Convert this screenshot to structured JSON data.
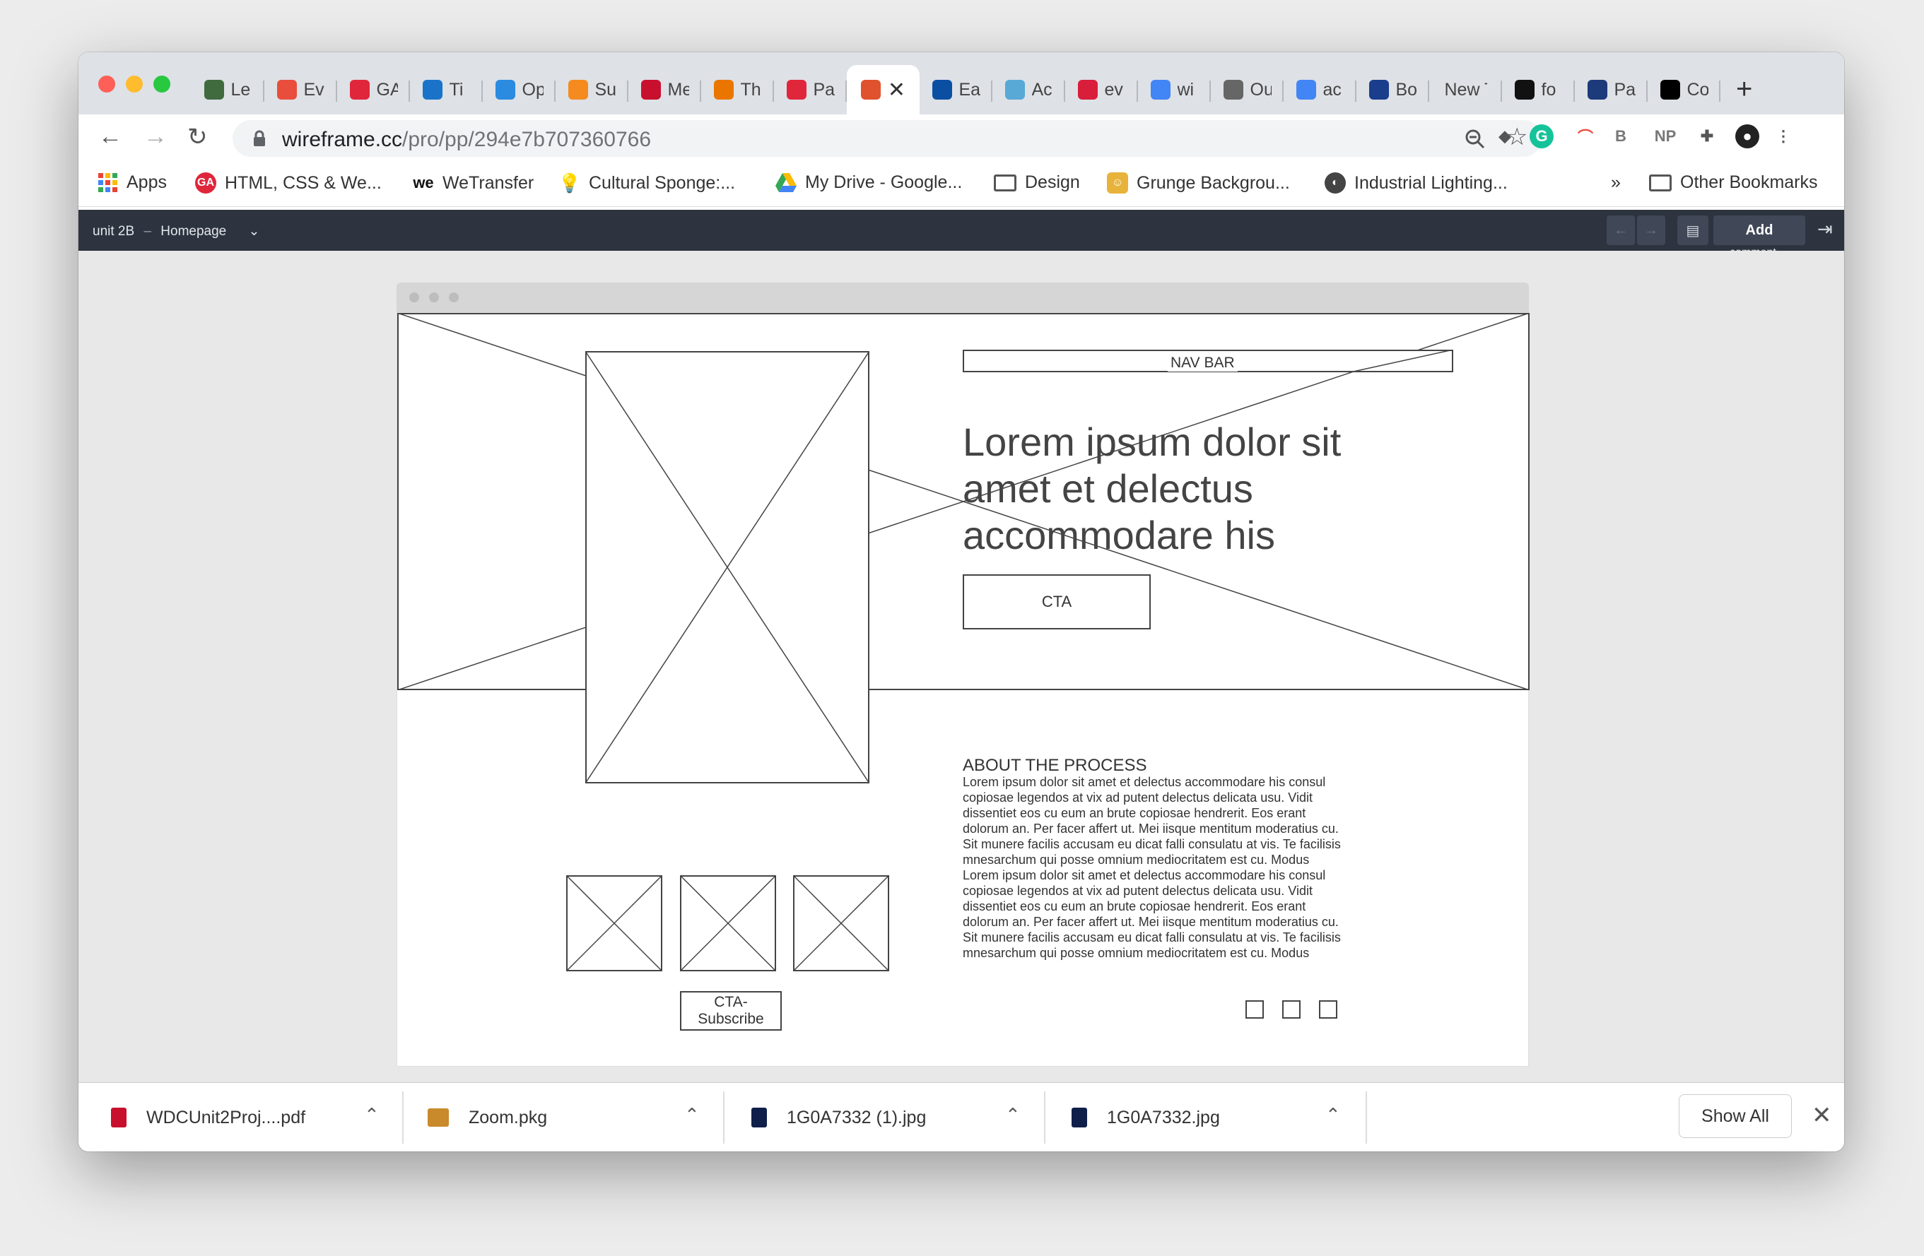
{
  "browser": {
    "tabs": [
      {
        "label": "Le",
        "icon": "tree-icon",
        "color": "#3f6b3f"
      },
      {
        "label": "Ev",
        "icon": "meetup-icon",
        "color": "#e94e3c"
      },
      {
        "label": "GA",
        "icon": "ga-icon",
        "color": "#e0263b"
      },
      {
        "label": "Ti",
        "icon": "video-icon",
        "color": "#1a73c9"
      },
      {
        "label": "Op",
        "icon": "tie-icon",
        "color": "#2a8be0"
      },
      {
        "label": "Su",
        "icon": "sublime-icon",
        "color": "#f58a1f"
      },
      {
        "label": "Me",
        "icon": "m-icon",
        "color": "#c8102e"
      },
      {
        "label": "Th",
        "icon": "blender-icon",
        "color": "#ea7600"
      },
      {
        "label": "Pa",
        "icon": "ga-icon",
        "color": "#e0263b"
      },
      {
        "label": "",
        "icon": "wireframe-icon",
        "color": "#e0522d",
        "active": true
      },
      {
        "label": "Ea",
        "icon": "fiji-icon",
        "color": "#0b4fa3"
      },
      {
        "label": "Ac",
        "icon": "drop-icon",
        "color": "#58a9d6"
      },
      {
        "label": "ev",
        "icon": "evian-icon",
        "color": "#d81e3a"
      },
      {
        "label": "wi",
        "icon": "google-icon",
        "color": "#4285f4"
      },
      {
        "label": "Ou",
        "icon": "pattern-icon",
        "color": "#666666"
      },
      {
        "label": "ac",
        "icon": "google-icon",
        "color": "#4285f4"
      },
      {
        "label": "Bo",
        "icon": "diamond-icon",
        "color": "#1a3e8c"
      },
      {
        "label": "New T",
        "icon": "",
        "color": "",
        "wide": true
      },
      {
        "label": "fo",
        "icon": "circle-n-icon",
        "color": "#111111"
      },
      {
        "label": "Pa",
        "icon": "usps-icon",
        "color": "#1d3b7a"
      },
      {
        "label": "Co",
        "icon": "ca-icon",
        "color": "#000000"
      }
    ],
    "new_tab_label": "+",
    "url_domain": "wireframe.cc",
    "url_path": "/pro/pp/294e7b707360766",
    "bookmarks": {
      "apps": "Apps",
      "items": [
        {
          "label": "HTML, CSS & We...",
          "icon": "ga-icon"
        },
        {
          "label": "WeTransfer",
          "icon": "wetransfer-icon"
        },
        {
          "label": "Cultural Sponge:...",
          "icon": "lightbulb-icon"
        },
        {
          "label": "My Drive - Google...",
          "icon": "drive-icon"
        },
        {
          "label": "Design",
          "icon": "folder-icon"
        },
        {
          "label": "Grunge Backgrou...",
          "icon": "bookmark-img-icon"
        },
        {
          "label": "Industrial Lighting...",
          "icon": "globe-icon"
        }
      ],
      "overflow": "»",
      "other": "Other Bookmarks"
    }
  },
  "app": {
    "project": "unit 2B",
    "separator": "–",
    "page": "Homepage",
    "add_label": "Add",
    "add_sub": "comment"
  },
  "wireframe": {
    "nav_label": "NAV BAR",
    "headline": "Lorem ipsum dolor sit amet et delectus accommodare his",
    "cta_label": "CTA",
    "about_title": "ABOUT THE PROCESS",
    "about_body": "Lorem ipsum dolor sit amet et delectus accommodare his consul copiosae legendos at vix ad putent delectus delicata usu. Vidit dissentiet eos cu eum an brute copiosae hendrerit. Eos erant dolorum an. Per facer affert ut. Mei iisque mentitum moderatius cu. Sit munere facilis accusam eu dicat falli consulatu at vis. Te facilisis mnesarchum qui posse omnium mediocritatem est cu. Modus Lorem ipsum dolor sit amet et delectus accommodare his consul copiosae legendos at vix ad putent delectus delicata usu. Vidit dissentiet eos cu eum an brute copiosae hendrerit. Eos erant dolorum an. Per facer affert ut. Mei iisque mentitum moderatius cu. Sit munere facilis accusam eu dicat falli consulatu at vis. Te facilisis mnesarchum qui posse omnium mediocritatem est cu. Modus",
    "subscribe_label": "CTA-\nSubscribe"
  },
  "downloads": {
    "items": [
      {
        "name": "WDCUnit2Proj....pdf",
        "icon": "pdf-icon",
        "color": "#c8102e"
      },
      {
        "name": "Zoom.pkg",
        "icon": "package-icon",
        "color": "#c98a2c"
      },
      {
        "name": "1G0A7332 (1).jpg",
        "icon": "photoshop-icon",
        "color": "#0f1f4a"
      },
      {
        "name": "1G0A7332.jpg",
        "icon": "photoshop-icon",
        "color": "#0f1f4a"
      }
    ],
    "show_all": "Show All"
  }
}
